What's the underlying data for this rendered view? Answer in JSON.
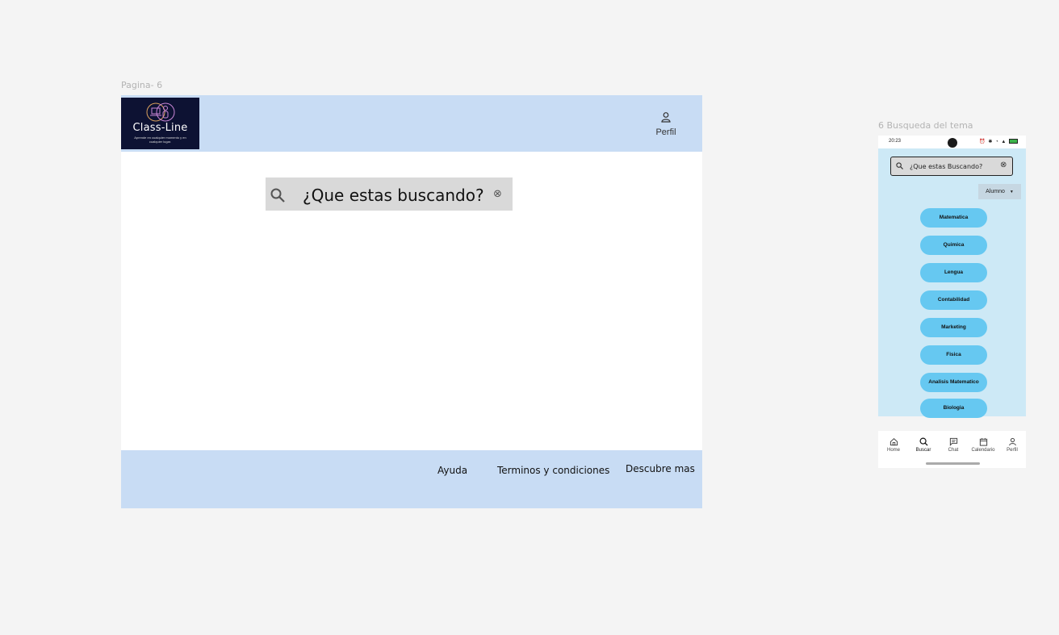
{
  "desktop": {
    "frame_label": "Pagina- 6",
    "logo": {
      "name": "Class-Line",
      "tagline": "Aprende en cualquier momento y en cualquier lugar."
    },
    "header": {
      "profile_label": "Perfil"
    },
    "search": {
      "placeholder": "¿Que estas buscando?"
    },
    "footer": {
      "links": [
        "Ayuda",
        "Terminos y condiciones",
        "Descubre mas"
      ]
    }
  },
  "mobile": {
    "frame_label": "6 Busqueda del tema",
    "status_bar": {
      "time": "20:23"
    },
    "search": {
      "placeholder": "¿Que estas Buscando?"
    },
    "role_select": {
      "value": "Alumno"
    },
    "topics": [
      "Matematica",
      "Quimica",
      "Lengua",
      "Contabilidad",
      "Marketing",
      "Fisica",
      "Analisis Matematico",
      "Biologia"
    ],
    "nav": [
      {
        "label": "Home",
        "icon": "home-icon"
      },
      {
        "label": "Buscar",
        "icon": "search-icon"
      },
      {
        "label": "Chat",
        "icon": "chat-icon"
      },
      {
        "label": "Calendario",
        "icon": "calendar-icon"
      },
      {
        "label": "Perfil",
        "icon": "user-icon"
      }
    ]
  },
  "colors": {
    "header": "#c8dcf4",
    "mobile_body": "#cde9f6",
    "topic_pill": "#66c8f1",
    "logo_bg": "#0d1233"
  }
}
